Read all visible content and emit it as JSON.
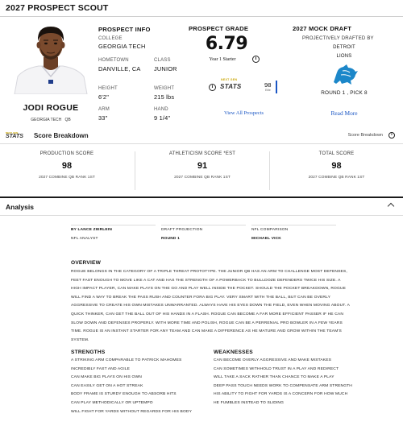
{
  "header": {
    "title": "2027 PROSPECT SCOUT"
  },
  "player": {
    "name": "JODI ROGUE",
    "school": "GEORGIA TECH",
    "position": "QB"
  },
  "prospect_info": {
    "title": "PROSPECT INFO",
    "college_label": "COLLEGE",
    "college": "GEORGIA TECH",
    "hometown_label": "HOMETOWN",
    "hometown": "DANVILLE, CA",
    "class_label": "CLASS",
    "class": "JUNIOR",
    "height_label": "HEIGHT",
    "height": "6'2\"",
    "weight_label": "WEIGHT",
    "weight": "215 lbs",
    "arm_label": "ARM",
    "arm": "33\"",
    "hand_label": "HAND",
    "hand": "9 1/4\""
  },
  "prospect_grade": {
    "title": "PROSPECT GRADE",
    "grade": "6.79",
    "grade_desc": "Year 1 Starter",
    "stats_prefix": "NEXT GEN",
    "stats_brand": "STATS",
    "stats_value": "98",
    "stats_sub": "Elite",
    "link": "View All Prospects"
  },
  "mock_draft": {
    "title": "2027 MOCK DRAFT",
    "projected_by": "PROJECTIVELY DRAFTED BY",
    "team_city": "DETROIT",
    "team_name": "LIONS",
    "round_pick": "ROUND 1 , PICK 8",
    "link": "Read More"
  },
  "breakdown": {
    "brand_prefix": "NEXT GEN",
    "brand": "STATS",
    "title": "Score Breakdown",
    "right_label": "Score Breakdown"
  },
  "scores": [
    {
      "label": "PRODUCTION SCORE",
      "value": "98",
      "sub": "2027 COMBINE QB RANK 1ST"
    },
    {
      "label": "ATHLETICISM SCORE *EST",
      "value": "91",
      "sub": "2027 COMBINE QB RANK 1ST"
    },
    {
      "label": "TOTAL SCORE",
      "value": "98",
      "sub": "2027 COMBINE QB RANK 1ST"
    }
  ],
  "analysis": {
    "title": "Analysis",
    "author_label": "BY LANCE ZIERLEIN",
    "author_role": "NFL ANALYST",
    "draft_proj_label": "DRAFT PROJECTION",
    "draft_proj_value": "ROUND 1",
    "comparison_label": "NFL COMPARISON",
    "comparison_value": "MICHAEL VICK",
    "overview_title": "OVERVIEW",
    "overview_text": "ROGUE BELONGS IN THE CATEGORY OF A TRIPLE THREAT PROTOTYPE. THE JUNIOR QB HAS AN ARM TO CHALLENGE MOST DEFENSES, FEET FAST ENOUGH TO MOVE LIKE A CAT AND HAS THE STRENGTH OF A POWERBACK TO BULLDOZE DEFENDERS TWICE HIS SIZE. A HIGH IMPACT PLAYER, CAN MAKE PLAYS ON THE GO AND PLAY WELL INSIDE THE POCKET. SHOULD THE POCKET BREAKDOWN, ROGUE WILL FIND A WAY TO BREAK THE PASS RUSH AND COUNTER FORA BIG PLAY. VERY SMART WITH THE BALL, BUT CAN BE OVERLY AGGRESSIVE TO CREATE HIS OWN MISTAKES UNWARRANTED. ALWAYS HAVE HIS EYES DOWN THE FIELD, EVEN WHEN MOVING ABOUT. A QUICK THINKER, CAN GET THE BALL OUT OF HIS HANDS IN A FLASH. ROGUE CAN BECOME A FAR MORE EFFICIENT PASSER IF HE CAN SLOW DOWN AND DEFENSES PROPERLY. WITH MORE TIME AND POLISH, ROGUE CAN BE A PERRENIAL PRO BOWLER IN A FEW YEARS TIME. ROGUE IS AN INSTANT STARTER FOR ANY TEAM AND CAN MAKE A DIFFERENCE AS HE MATURE AND GROW WITHIN THE TEAM'S SYSTEM.",
    "strengths_title": "STRENGTHS",
    "strengths": [
      "A STRIKING ARM COMPARABLE TO PATRICK MAHOMES",
      "INCREDIBLY FAST AND AGILE",
      "CAN MAKE BIG PLAYS ON HIS OWN",
      "CAN EASILY GET ON A HOT STREAK",
      "BODY FRAME IS STURDY ENOUGH TO ABSORB HITS",
      "CAN PLAY METHODICALLY OR UPTEMPO",
      "WILL FIGHT FOR YARDS WITHOUT REGARDS FOR HIS BODY"
    ],
    "weaknesses_title": "WEAKNESSES",
    "weaknesses": [
      "CAN BECOME OVERLY AGGRESSIVE AND MAKE MISTAKES",
      "CAN SOMETIMES WITHHOLD TRUST IN A PLAY AND REDIRECT",
      "WILL TAKE A SACK RATHER THAN CHANCE TO MAKE A PLAY",
      "DEEP PASS TOUCH NEEDS WORK TO COMPENSATE ARM STRENGTH",
      "HIS ABILITY TO FIGHT FOR YARDS IS A CONCERN FOR HOW MUCH HE FUMBLES INSTEAD TO SLIDING"
    ]
  },
  "colors": {
    "accent": "#1a56c4",
    "lions_blue": "#1c87c9",
    "rule": "#1a1a1a"
  },
  "icons": [
    "info-icon",
    "next-gen-stats-logo",
    "lions-logo",
    "chevron-up-icon",
    "player-avatar"
  ]
}
